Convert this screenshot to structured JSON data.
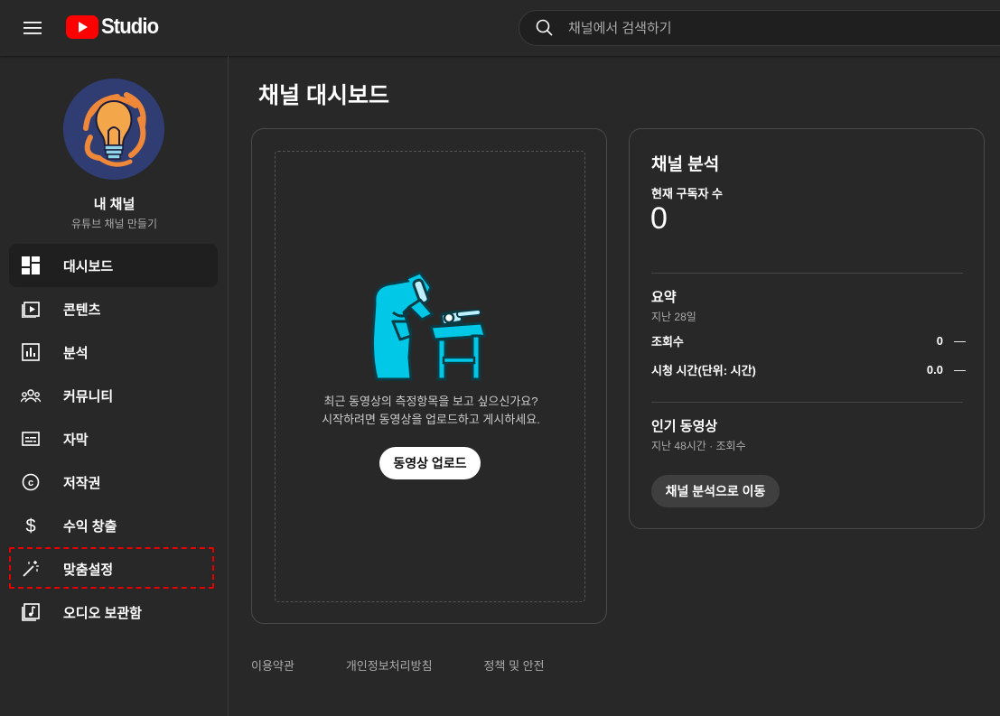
{
  "header": {
    "logo_text": "Studio",
    "search_placeholder": "채널에서 검색하기"
  },
  "sidebar": {
    "channel_name": "내 채널",
    "channel_subtitle": "유튜브 채널 만들기",
    "items": [
      {
        "label": "대시보드",
        "icon": "dashboard-icon",
        "active": true
      },
      {
        "label": "콘텐츠",
        "icon": "content-icon"
      },
      {
        "label": "분석",
        "icon": "analytics-icon"
      },
      {
        "label": "커뮤니티",
        "icon": "community-icon"
      },
      {
        "label": "자막",
        "icon": "subtitles-icon"
      },
      {
        "label": "저작권",
        "icon": "copyright-icon"
      },
      {
        "label": "수익 창출",
        "icon": "monetization-icon"
      },
      {
        "label": "맞춤설정",
        "icon": "magic-wand-icon",
        "highlighted": true
      },
      {
        "label": "오디오 보관함",
        "icon": "audio-library-icon"
      }
    ]
  },
  "main": {
    "title": "채널 대시보드",
    "upload": {
      "line1": "최근 동영상의 측정항목을 보고 싶으신가요?",
      "line2": "시작하려면 동영상을 업로드하고 게시하세요.",
      "button": "동영상 업로드"
    },
    "analytics": {
      "title": "채널 분석",
      "subscribers_label": "현재 구독자 수",
      "subscribers_value": "0",
      "summary_title": "요약",
      "summary_period": "지난 28일",
      "stats": [
        {
          "label": "조회수",
          "value": "0",
          "trend": "—"
        },
        {
          "label": "시청 시간(단위: 시간)",
          "value": "0.0",
          "trend": "—"
        }
      ],
      "popular_title": "인기 동영상",
      "popular_sub": "지난 48시간 · 조회수",
      "button": "채널 분석으로 이동"
    }
  },
  "footer": {
    "links": [
      "이용약관",
      "개인정보처리방침",
      "정책 및 안전"
    ]
  },
  "colors": {
    "background": "#282828",
    "brand_red": "#ff0000",
    "highlight_border": "#e60000",
    "illustration_teal": "#00c8e6"
  }
}
